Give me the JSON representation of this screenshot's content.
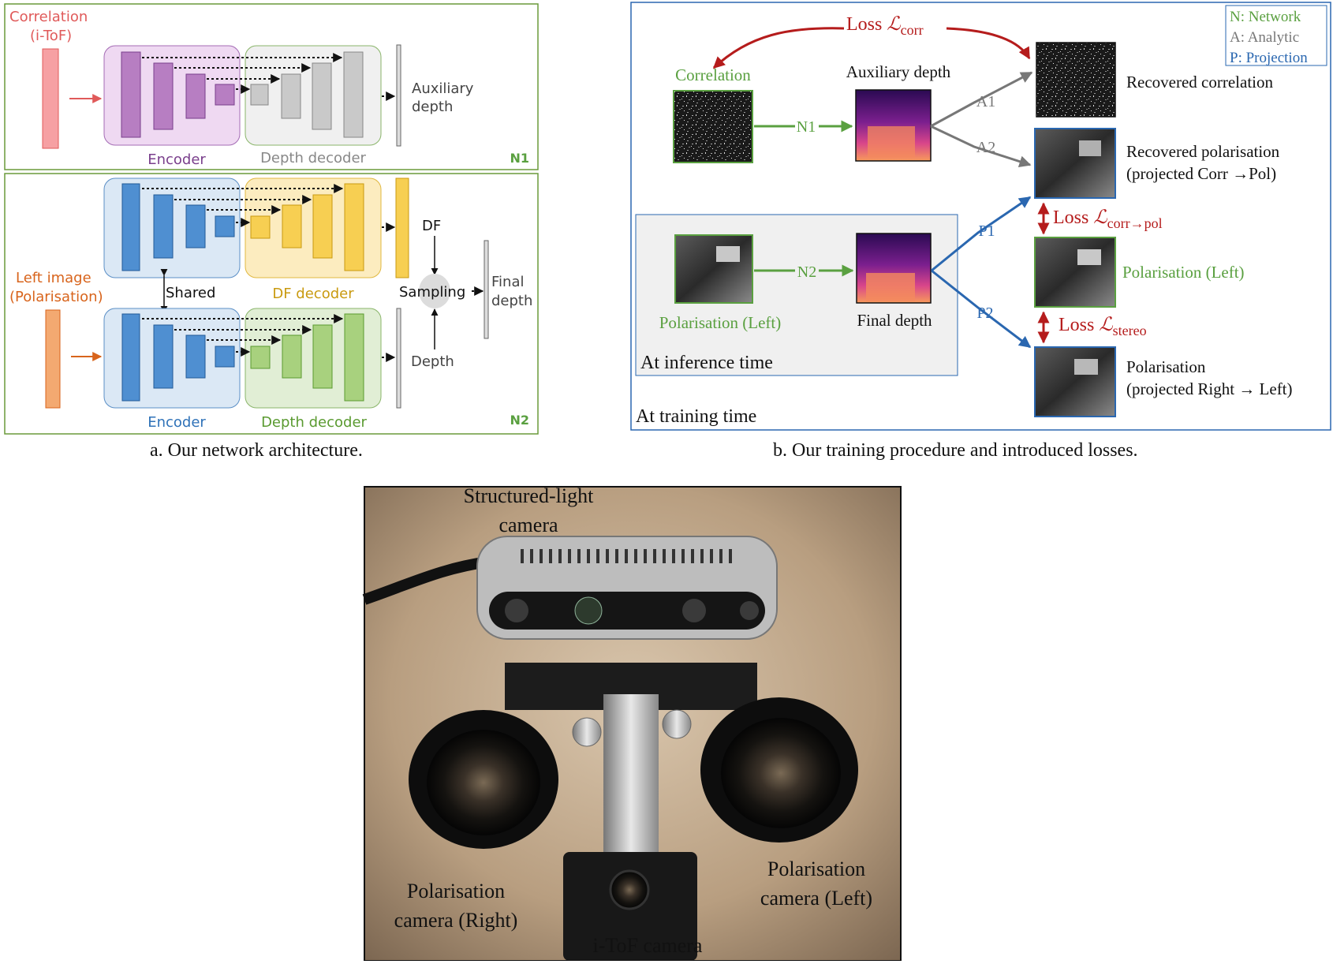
{
  "colors": {
    "panel_border": "#6a9a3a",
    "network_green": "#5aa040",
    "analytic_gray": "#777777",
    "projection_blue": "#2a67b0",
    "loss_red": "#b51c1c",
    "correlation_red": "#e05a5a",
    "polarisation_orange": "#d8641c",
    "encoder_purple": "#8b4a9e",
    "encoder_blue": "#2f72b8",
    "df_yellow": "#c99a10",
    "decoder_green": "#5a9a30"
  },
  "panel_a": {
    "caption": "a. Our network architecture.",
    "n1": {
      "tag": "N1",
      "input_label": "Correlation (i-ToF)",
      "encoder_label": "Encoder",
      "decoder_label": "Depth decoder",
      "output_label": "Auxiliary depth"
    },
    "n2": {
      "tag": "N2",
      "input_label": "Left image (Polarisation)",
      "shared_label": "Shared",
      "df_decoder_label": "DF decoder",
      "encoder_label": "Encoder",
      "depth_decoder_label": "Depth decoder",
      "df_label": "DF",
      "depth_label": "Depth",
      "sampling_label": "Sampling",
      "final_label": "Final depth"
    }
  },
  "panel_b": {
    "caption": "b. Our training procedure and introduced losses.",
    "legend": [
      "N: Network",
      "A: Analytic",
      "P: Projection"
    ],
    "loss_corr": "Loss ℒcorr",
    "loss_corr_pol": "Loss ℒcorr→pol",
    "loss_stereo": "Loss ℒstereo",
    "correlation_label": "Correlation",
    "aux_depth_label": "Auxiliary depth",
    "recovered_corr_label": "Recovered correlation",
    "recovered_pol_label": "Recovered polarisation",
    "projected_corr_pol_label": "(projected Corr →Pol)",
    "pol_left_right_label": "Polarisation (Left)",
    "pol_label": "Polarisation",
    "projected_right_left_label": "(projected Right → Left)",
    "pol_left_label": "Polarisation (Left)",
    "final_depth_label": "Final depth",
    "inference_label": "At inference time",
    "training_label": "At training time",
    "edges": {
      "n1": "N1",
      "n2": "N2",
      "a1": "A1",
      "a2": "A2",
      "p1": "P1",
      "p2": "P2"
    }
  },
  "photo": {
    "structured_light": "Structured-light camera",
    "pol_right": "Polarisation camera (Right)",
    "pol_left": "Polarisation camera (Left)",
    "itof": "i-ToF camera"
  }
}
